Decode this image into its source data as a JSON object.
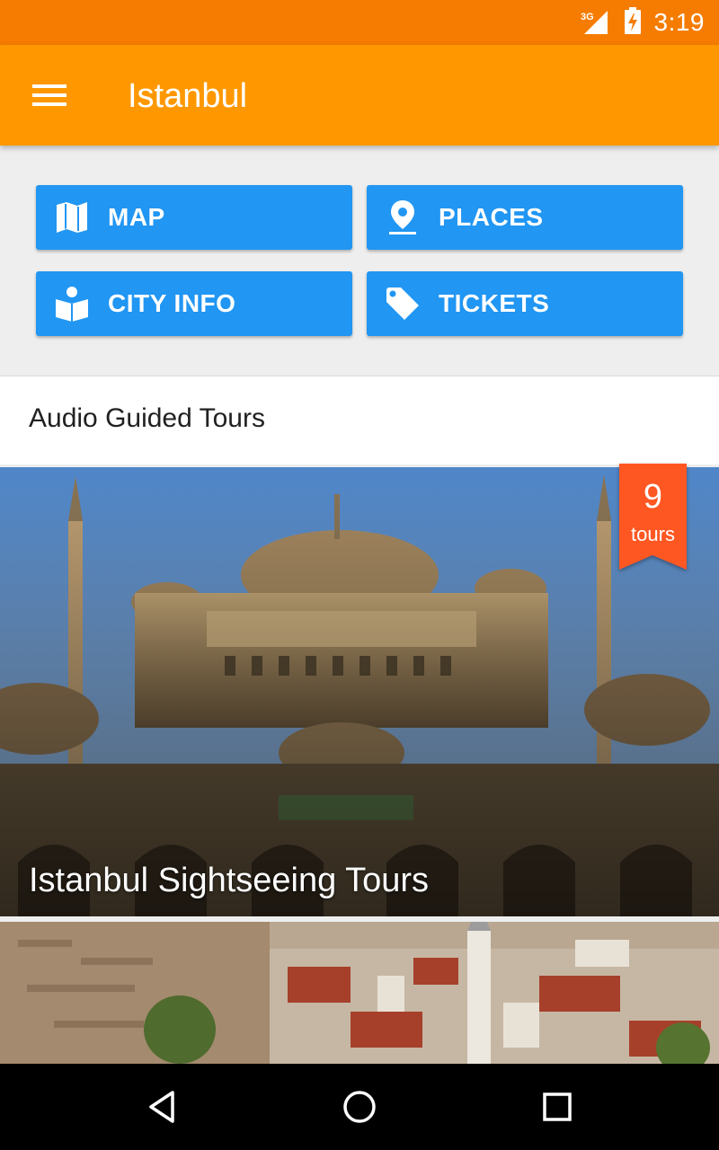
{
  "status_bar": {
    "network_label": "3G",
    "time": "3:19",
    "icons": [
      "signal-icon",
      "battery-charging-icon"
    ]
  },
  "app_bar": {
    "menu_icon": "hamburger-menu-icon",
    "title": "Istanbul"
  },
  "actions": [
    {
      "label": "MAP",
      "icon": "map-icon"
    },
    {
      "label": "PLACES",
      "icon": "place-pin-icon"
    },
    {
      "label": "CITY INFO",
      "icon": "city-info-book-icon"
    },
    {
      "label": "TICKETS",
      "icon": "ticket-tag-icon"
    }
  ],
  "section": {
    "title": "Audio Guided Tours"
  },
  "cards": [
    {
      "title": "Istanbul Sightseeing Tours",
      "image": "blue-mosque-photo",
      "badge": {
        "count": "9",
        "unit": "tours"
      }
    },
    {
      "title": "",
      "image": "istanbul-old-city-photo"
    }
  ],
  "nav_bar": {
    "buttons": [
      "back-icon",
      "home-icon",
      "recent-apps-icon"
    ]
  },
  "colors": {
    "status_bar": "#f57c00",
    "app_bar": "#ff9800",
    "action_button": "#2196f3",
    "badge": "#ff5722",
    "background": "#eeeeee"
  }
}
